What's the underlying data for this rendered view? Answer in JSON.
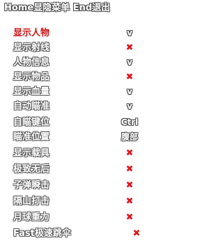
{
  "header": {
    "title": "Home显隐菜单 End退出"
  },
  "menu": {
    "items": [
      {
        "label": "显示人物",
        "value": "v",
        "state": "on",
        "active": true
      },
      {
        "label": "显示射线",
        "value": "✖",
        "state": "off",
        "active": false
      },
      {
        "label": "人物信息",
        "value": "v",
        "state": "on",
        "active": false
      },
      {
        "label": "显示物品",
        "value": "✖",
        "state": "off",
        "active": false
      },
      {
        "label": "显示血量",
        "value": "v",
        "state": "on",
        "active": false
      },
      {
        "label": "自动瞄准",
        "value": "v",
        "state": "on",
        "active": false
      },
      {
        "label": "自瞄键位",
        "value": "Ctrl",
        "state": "text",
        "active": false
      },
      {
        "label": "瞄准位置",
        "value": "腹部",
        "state": "text",
        "active": false
      },
      {
        "label": "显示载具",
        "value": "✖",
        "state": "off",
        "active": false
      },
      {
        "label": "极致无后",
        "value": "✖",
        "state": "off",
        "active": false
      },
      {
        "label": "子弹瞬击",
        "value": "✖",
        "state": "off",
        "active": false
      },
      {
        "label": "隔山打击",
        "value": "✖",
        "state": "off",
        "active": false
      },
      {
        "label": "月球重力",
        "value": "✖",
        "state": "off",
        "active": false
      },
      {
        "label": "Fast极速跳伞",
        "value": "✖",
        "state": "off",
        "active": false
      }
    ]
  },
  "colors": {
    "active_label": "#cc1111",
    "off_mark": "#e0181b",
    "label": "#ffffff"
  }
}
